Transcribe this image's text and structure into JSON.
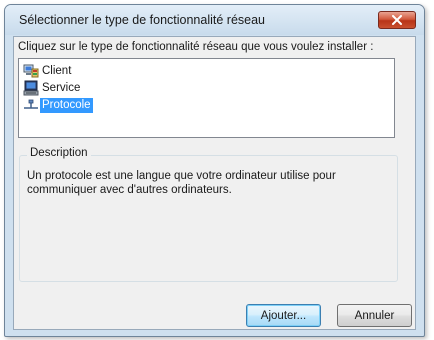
{
  "window": {
    "title": "Sélectionner le type de fonctionnalité réseau",
    "close_icon": "close-icon"
  },
  "dialog": {
    "instruction": "Cliquez sur le type de fonctionnalité réseau que vous voulez installer :",
    "list": {
      "items": [
        {
          "label": "Client",
          "icon": "network-client-icon",
          "selected": false
        },
        {
          "label": "Service",
          "icon": "network-service-icon",
          "selected": false
        },
        {
          "label": "Protocole",
          "icon": "network-protocol-icon",
          "selected": true
        }
      ]
    },
    "description": {
      "legend": "Description",
      "text": "Un protocole est une langue que votre ordinateur utilise pour communiquer avec d'autres ordinateurs."
    },
    "buttons": {
      "add_label": "Ajouter...",
      "cancel_label": "Annuler"
    }
  },
  "colors": {
    "selection": "#3399ff",
    "close_button": "#c9502f",
    "dialog_frame": "#cfe0ef"
  }
}
